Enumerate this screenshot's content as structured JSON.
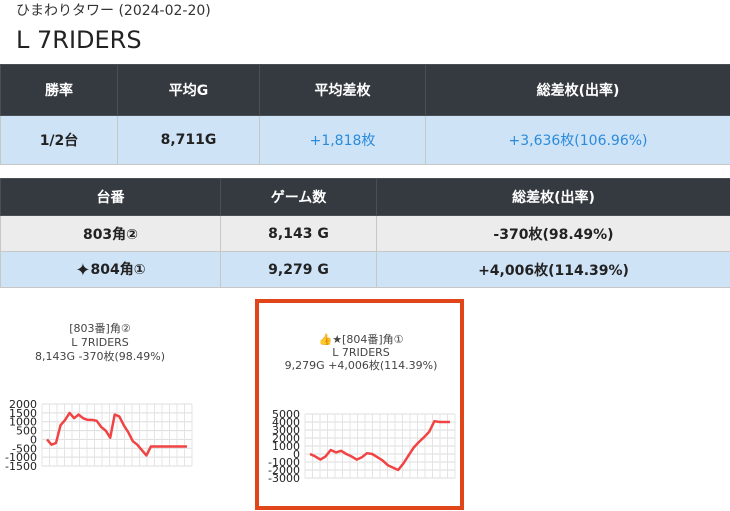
{
  "header": {
    "subtitle": "ひまわりタワー (2024-02-20)",
    "title": "L 7RIDERS"
  },
  "summary": {
    "headers": [
      "勝率",
      "平均G",
      "平均差枚",
      "総差枚(出率)"
    ],
    "values": [
      "1/2台",
      "8,711G",
      "+1,818枚",
      "+3,636枚(106.96%)"
    ]
  },
  "machines": {
    "headers": [
      "台番",
      "ゲーム数",
      "総差枚(出率)"
    ],
    "rows": [
      {
        "number": "803角②",
        "games": "8,143 G",
        "diff": "-370枚(98.49%)"
      },
      {
        "number": "804角①",
        "games": "9,279 G",
        "diff": "+4,006枚(114.39%)"
      }
    ]
  },
  "charts": [
    {
      "caption1": "[803番]角②",
      "caption2": "L 7RIDERS",
      "caption3": "8,143G -370枚(98.49%)",
      "ticks": [
        "2000",
        "1500",
        "1000",
        "500",
        "0",
        "-500",
        "-1000",
        "-1500"
      ]
    },
    {
      "caption1": "👍★[804番]角①",
      "caption2": "L 7RIDERS",
      "caption3": "9,279G +4,006枚(114.39%)",
      "ticks": [
        "5000",
        "4000",
        "3000",
        "2000",
        "1000",
        "0",
        "-1000",
        "-2000",
        "-3000"
      ]
    }
  ],
  "chart_data": [
    {
      "type": "line",
      "ylim": [
        -1500,
        2000
      ],
      "grid": true,
      "line_color": "#f04444",
      "y": [
        0,
        -300,
        -200,
        800,
        1100,
        1500,
        1200,
        1400,
        1200,
        1100,
        1100,
        1050,
        700,
        500,
        100,
        1400,
        1300,
        800,
        400,
        -100,
        -300,
        -600,
        -900,
        -400,
        -400,
        -400,
        -400,
        -400,
        -400,
        -400,
        -400,
        -400
      ]
    },
    {
      "type": "line",
      "ylim": [
        -3000,
        5000
      ],
      "grid": true,
      "line_color": "#f04444",
      "y": [
        0,
        -300,
        -700,
        -300,
        500,
        200,
        400,
        0,
        -300,
        -700,
        -400,
        100,
        0,
        -400,
        -800,
        -1400,
        -1700,
        -2000,
        -1200,
        -200,
        800,
        1500,
        2100,
        2800,
        4100,
        4000,
        4000,
        4000
      ]
    }
  ]
}
